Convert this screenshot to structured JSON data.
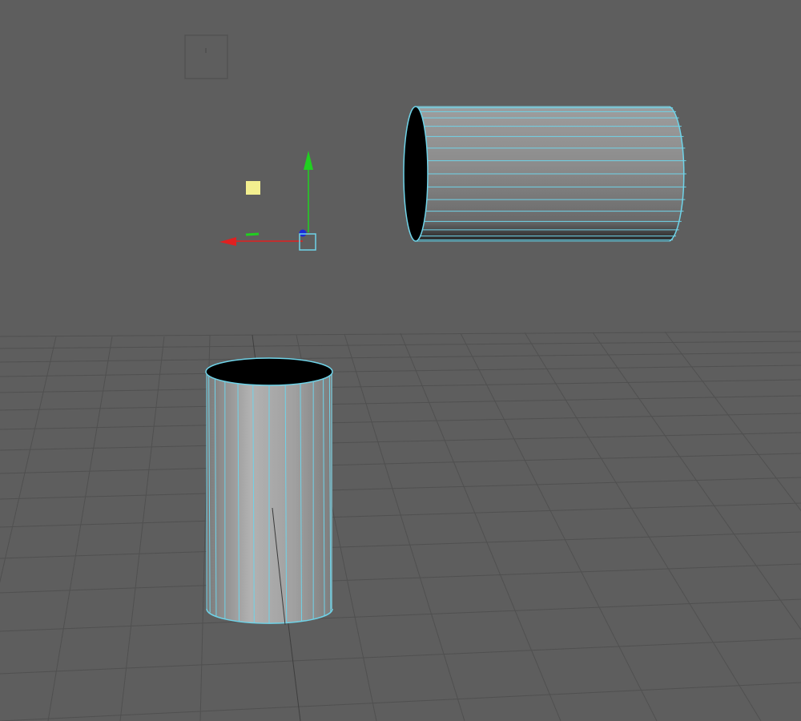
{
  "viewport": {
    "label": "",
    "background": "#5e5e5e",
    "grid_color": "#4f4f4f",
    "wireframe_color": "#6fd3e8"
  },
  "objects": [
    {
      "name": "cylinder-horizontal",
      "type": "cylinder",
      "orientation": "horizontal",
      "selected": true,
      "open_end": "left"
    },
    {
      "name": "cylinder-vertical",
      "type": "cylinder",
      "orientation": "vertical",
      "selected": true,
      "open_end": "top"
    }
  ],
  "manipulator": {
    "x_axis_color": "#e02020",
    "y_axis_color": "#20d020",
    "z_axis_color": "#1a2ad8",
    "center_handle_color": "#6fd3e8",
    "pivot_color": "#f3ef8f"
  },
  "icons": [
    "camera-frame-icon",
    "move-manipulator-icon",
    "pivot-handle-icon"
  ]
}
